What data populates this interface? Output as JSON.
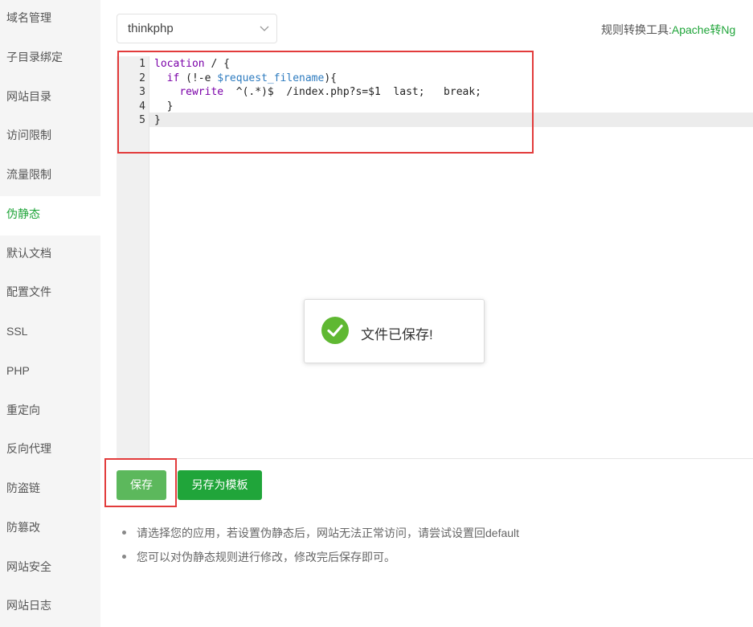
{
  "sidebar": {
    "items": [
      {
        "label": "域名管理"
      },
      {
        "label": "子目录绑定"
      },
      {
        "label": "网站目录"
      },
      {
        "label": "访问限制"
      },
      {
        "label": "流量限制"
      },
      {
        "label": "伪静态",
        "active": true
      },
      {
        "label": "默认文档"
      },
      {
        "label": "配置文件"
      },
      {
        "label": "SSL"
      },
      {
        "label": "PHP"
      },
      {
        "label": "重定向"
      },
      {
        "label": "反向代理"
      },
      {
        "label": "防盗链"
      },
      {
        "label": "防篡改"
      },
      {
        "label": "网站安全"
      },
      {
        "label": "网站日志"
      }
    ]
  },
  "template_select": {
    "value": "thinkphp",
    "icon": "chevron-down-icon"
  },
  "converter": {
    "label": "规则转换工具:",
    "link": "Apache转Ng"
  },
  "editor": {
    "line_numbers": [
      "1",
      "2",
      "3",
      "4",
      "5"
    ],
    "lines": [
      "location / {",
      "  if (!-e $request_filename){",
      "    rewrite  ^(.*)$  /index.php?s=$1  last;   break;",
      "  }",
      "}"
    ],
    "active_line": 5
  },
  "toast": {
    "message": "文件已保存!",
    "icon": "check-circle-icon"
  },
  "buttons": {
    "save": "保存",
    "save_as_template": "另存为模板"
  },
  "tips": [
    "请选择您的应用，若设置伪静态后，网站无法正常访问，请尝试设置回default",
    "您可以对伪静态规则进行修改，修改完后保存即可。"
  ],
  "colors": {
    "accent": "#20a53a",
    "save_button": "#5cb85c",
    "highlight_box": "#e23b3b"
  }
}
